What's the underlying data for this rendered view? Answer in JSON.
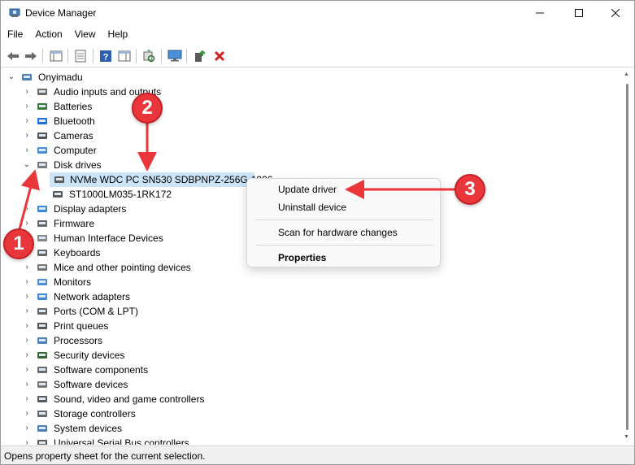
{
  "window": {
    "title": "Device Manager",
    "controls": {
      "minimize": "—",
      "maximize": "☐",
      "close": "✕"
    }
  },
  "menu": [
    "File",
    "Action",
    "View",
    "Help"
  ],
  "tree": {
    "root": "Onyimadu",
    "categories": [
      "Audio inputs and outputs",
      "Batteries",
      "Bluetooth",
      "Cameras",
      "Computer",
      "Disk drives",
      "Display adapters",
      "Firmware",
      "Human Interface Devices",
      "Keyboards",
      "Mice and other pointing devices",
      "Monitors",
      "Network adapters",
      "Ports (COM & LPT)",
      "Print queues",
      "Processors",
      "Security devices",
      "Software components",
      "Software devices",
      "Sound, video and game controllers",
      "Storage controllers",
      "System devices",
      "Universal Serial Bus controllers"
    ],
    "disk_children": [
      "NVMe WDC PC SN530 SDBPNPZ-256G-1006",
      "ST1000LM035-1RK172"
    ]
  },
  "context_menu": {
    "update": "Update driver",
    "uninstall": "Uninstall device",
    "scan": "Scan for hardware changes",
    "properties": "Properties"
  },
  "status": "Opens property sheet for the current selection.",
  "annotations": {
    "one": "1",
    "two": "2",
    "three": "3"
  },
  "colors": {
    "accent": "#e8363b",
    "selection": "#cce4f7"
  }
}
